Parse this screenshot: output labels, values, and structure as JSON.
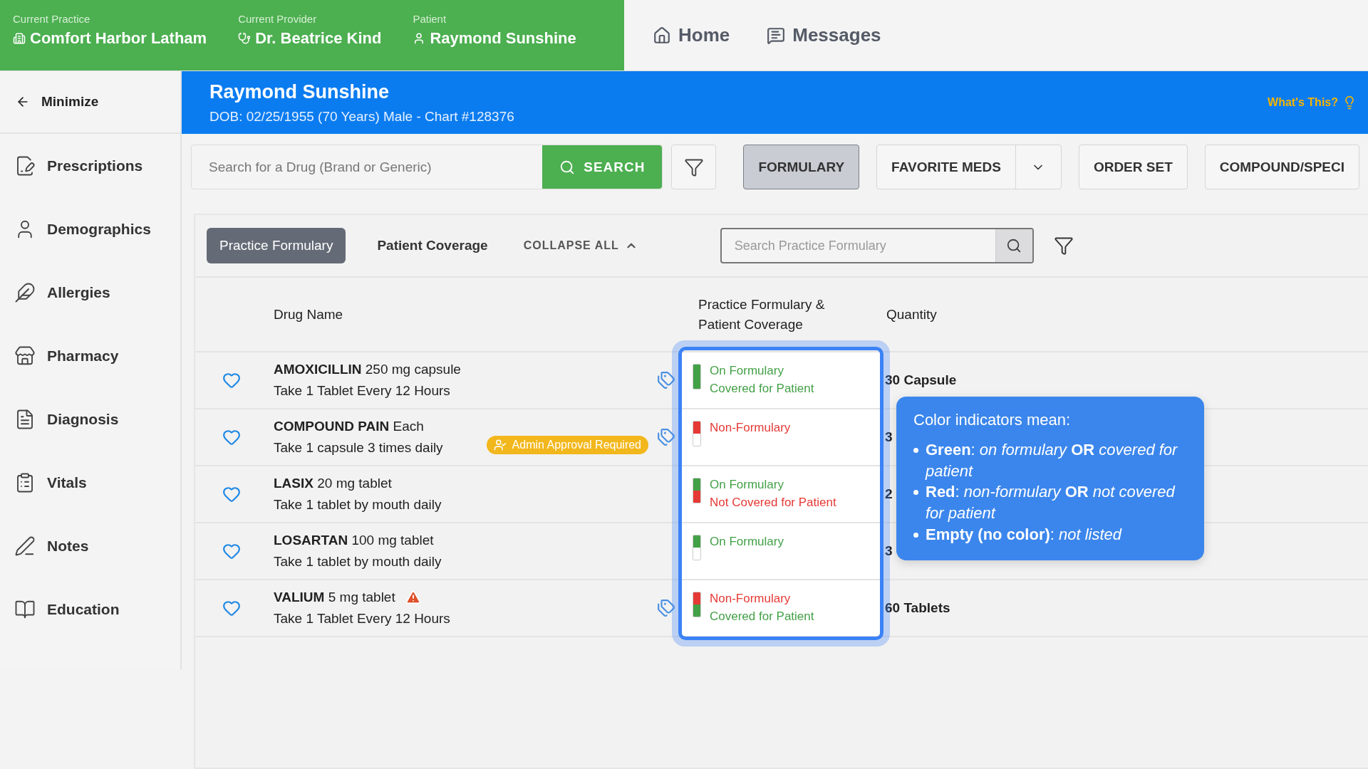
{
  "context": [
    {
      "label": "Current Practice",
      "value": "Comfort Harbor Latham",
      "kind": "practice"
    },
    {
      "label": "Current Provider",
      "value": "Dr. Beatrice Kind",
      "kind": "provider"
    },
    {
      "label": "Patient",
      "value": "Raymond Sunshine",
      "kind": "patient"
    }
  ],
  "nav": [
    {
      "label": "Home",
      "kind": "home"
    },
    {
      "label": "Messages",
      "kind": "messages"
    }
  ],
  "sidebar": {
    "minimize": "Minimize",
    "items": [
      {
        "label": "Prescriptions",
        "kind": "prescriptions"
      },
      {
        "label": "Demographics",
        "kind": "demographics"
      },
      {
        "label": "Allergies",
        "kind": "allergies"
      },
      {
        "label": "Pharmacy",
        "kind": "pharmacy"
      },
      {
        "label": "Diagnosis",
        "kind": "diagnosis"
      },
      {
        "label": "Vitals",
        "kind": "vitals"
      },
      {
        "label": "Notes",
        "kind": "notes"
      },
      {
        "label": "Education",
        "kind": "education"
      }
    ]
  },
  "patient": {
    "name": "Raymond Sunshine",
    "details": "DOB: 02/25/1955 (70 Years) Male - Chart #128376",
    "help": "What's This?"
  },
  "search": {
    "placeholder": "Search for a Drug (Brand or Generic)",
    "button": "SEARCH"
  },
  "actions": [
    {
      "label": "FORMULARY",
      "selected": true,
      "dropdown": false
    },
    {
      "label": "FAVORITE MEDS",
      "selected": false,
      "dropdown": true
    },
    {
      "label": "ORDER SET",
      "selected": false,
      "dropdown": false
    },
    {
      "label": "COMPOUND/SPECI",
      "selected": false,
      "dropdown": false
    }
  ],
  "list_tabs": [
    {
      "label": "Practice Formulary",
      "selected": true
    },
    {
      "label": "Patient Coverage",
      "selected": false
    }
  ],
  "collapse": "COLLAPSE ALL",
  "formulary_search": {
    "placeholder": "Search Practice Formulary"
  },
  "table": {
    "columns": [
      "Drug Name",
      "Practice Formulary & Patient Coverage",
      "Quantity"
    ],
    "rows": [
      {
        "name": "AMOXICILLIN",
        "strength": "250 mg capsule",
        "sig": "Take 1 Tablet Every 12 Hours",
        "tag": true,
        "warning": false,
        "indicator": [
          {
            "filled": true,
            "color": "#43a047"
          },
          {
            "filled": true,
            "color": "#43a047"
          }
        ],
        "status": [
          {
            "text": "On Formulary",
            "color": "#43a047"
          },
          {
            "text": "Covered for Patient",
            "color": "#43a047"
          }
        ],
        "quantity": "30 Capsule"
      },
      {
        "name": "COMPOUND PAIN",
        "strength": "Each",
        "sig": "Take 1 capsule 3 times daily",
        "badge": "Admin Approval Required",
        "tag": true,
        "warning": false,
        "indicator": [
          {
            "filled": true,
            "color": "#e53935"
          },
          {
            "filled": false
          }
        ],
        "status": [
          {
            "text": "Non-Formulary",
            "color": "#e53935"
          }
        ],
        "quantity": "3"
      },
      {
        "name": "LASIX",
        "strength": "20 mg tablet",
        "sig": "Take 1 tablet by mouth daily",
        "tag": false,
        "warning": false,
        "indicator": [
          {
            "filled": true,
            "color": "#43a047"
          },
          {
            "filled": true,
            "color": "#e53935"
          }
        ],
        "status": [
          {
            "text": "On Formulary",
            "color": "#43a047"
          },
          {
            "text": "Not Covered for Patient",
            "color": "#e53935"
          }
        ],
        "quantity": "2"
      },
      {
        "name": "LOSARTAN",
        "strength": "100 mg tablet",
        "sig": "Take 1 tablet by mouth daily",
        "tag": false,
        "warning": false,
        "indicator": [
          {
            "filled": true,
            "color": "#43a047"
          },
          {
            "filled": false
          }
        ],
        "status": [
          {
            "text": "On Formulary",
            "color": "#43a047"
          }
        ],
        "quantity": "3"
      },
      {
        "name": "VALIUM",
        "strength": "5 mg tablet",
        "sig": "Take 1 Tablet Every 12 Hours",
        "tag": true,
        "warning": true,
        "indicator": [
          {
            "filled": true,
            "color": "#e53935"
          },
          {
            "filled": true,
            "color": "#43a047"
          }
        ],
        "status": [
          {
            "text": "Non-Formulary",
            "color": "#e53935"
          },
          {
            "text": "Covered for Patient",
            "color": "#43a047"
          }
        ],
        "quantity": "60 Tablets"
      }
    ]
  },
  "legend": {
    "title": "Color indicators mean:",
    "items": [
      "**Green**: *on formulary* **OR** *covered for patient*",
      "**Red**: *non-formulary* **OR** *not covered for patient*",
      "**Empty (no color)**: *not listed*"
    ]
  }
}
